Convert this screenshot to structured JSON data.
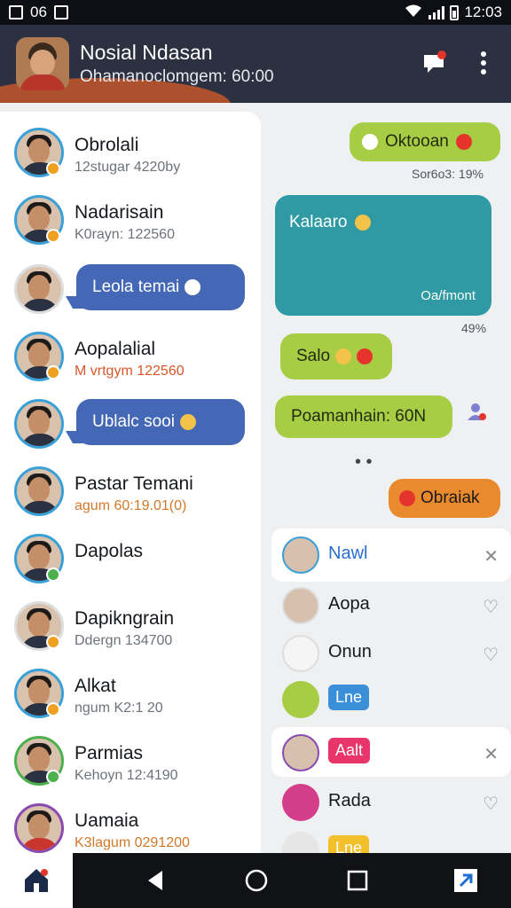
{
  "status": {
    "left_text": "06",
    "time": "12:03"
  },
  "header": {
    "title": "Nosial Ndasan",
    "subtitle": "Ohamanoclomgem: 60:00"
  },
  "contacts": [
    {
      "name": "Obrolali",
      "meta": "12stugar 4220by"
    },
    {
      "name": "Nadarisain",
      "meta": "K0rayn: 122560"
    },
    {
      "name": "Aopalalial",
      "meta": "M vrtgym 122560"
    },
    {
      "name": "Pastar Temani",
      "meta": "agum 60:19.01(0)"
    },
    {
      "name": "Dapolas",
      "meta": ""
    },
    {
      "name": "Dapikngrain",
      "meta": "Ddergn 134700"
    },
    {
      "name": "Alkat",
      "meta": "ngum K2:1 20"
    },
    {
      "name": "Parmias",
      "meta": "Kehoyn 12:4190"
    },
    {
      "name": "Uamaia",
      "meta": "K3lagum 0291200"
    }
  ],
  "left_bubbles": [
    {
      "text": "Leola temai"
    },
    {
      "text": "Ublalc sooi"
    }
  ],
  "chat": {
    "b1": "Oktooan",
    "b1_meta": "Sor6o3: 19%",
    "b2": "Kalaaro",
    "b2_sub": "Oa/fmont",
    "b2_meta": "49%",
    "b3": "Salo",
    "b4": "Poamanhain: 60N",
    "b5": "Obraiak"
  },
  "list": [
    {
      "name": "Nawl",
      "kind": "header"
    },
    {
      "name": "Aopa"
    },
    {
      "name": "Onun"
    },
    {
      "name": "Lne",
      "kind": "tag",
      "color": "#3a8fd8"
    },
    {
      "name": "Aalt",
      "kind": "tag-header",
      "color": "#e8356a"
    },
    {
      "name": "Rada"
    },
    {
      "name": "Lne",
      "kind": "tag",
      "color": "#f2c02a"
    }
  ]
}
